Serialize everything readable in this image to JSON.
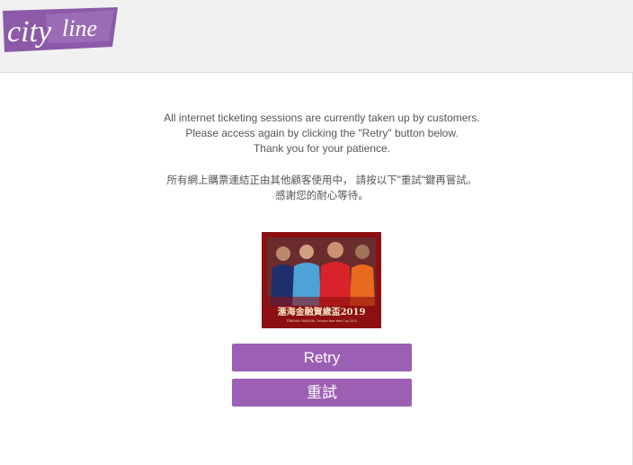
{
  "header": {
    "logo_text": "cityline",
    "brand_color": "#8c5aa8",
    "background": "#f1f1f1"
  },
  "message": {
    "en_line1": "All internet ticketing sessions are currently taken up by customers.",
    "en_line2": "Please access again by clicking the \"Retry\" button below.",
    "en_line3": "Thank you for your patience.",
    "zh_line1": "所有網上購票連結正由其他顧客使用中， 請按以下\"重試\"鍵再嘗試。",
    "zh_line2": "感謝您的耐心等待。"
  },
  "banner": {
    "title": "滙海金融賀歲盃2019",
    "subtitle": "TONGHAI FINANCIAL Chinese New Year Cup 2019"
  },
  "buttons": {
    "retry_label": "Retry",
    "retry_zh_label": "重試",
    "button_color": "#9b5fb3"
  }
}
